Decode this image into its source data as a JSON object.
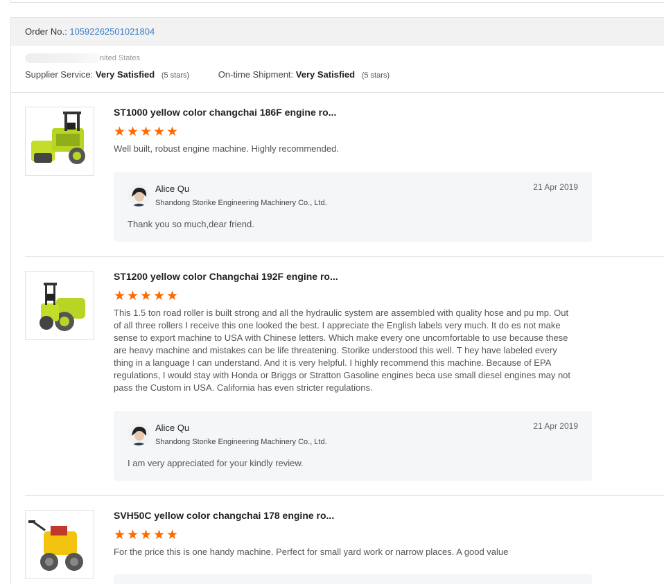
{
  "order": {
    "label": "Order No.:",
    "number": "10592262501021804"
  },
  "buyer": {
    "country": "nited States"
  },
  "ratings": {
    "supplier_service": {
      "label": "Supplier Service:",
      "value": "Very Satisfied",
      "stars": "(5 stars)"
    },
    "shipment": {
      "label": "On-time Shipment:",
      "value": "Very Satisfied",
      "stars": "(5 stars)"
    }
  },
  "colors": {
    "star": "#ff6a00",
    "link": "#3c7fc4",
    "reply_bg": "#f5f6f8"
  },
  "reviews": [
    {
      "title": "ST1000 yellow color changchai 186F engine ro...",
      "rating": 5,
      "text": "Well built, robust engine machine. Highly recommended.",
      "reply": {
        "name": "Alice Qu",
        "company": "Shandong Storike Engineering Machinery Co., Ltd.",
        "date": "21 Apr 2019",
        "message": "Thank you so much,dear friend."
      }
    },
    {
      "title": "ST1200 yellow color Changchai 192F engine ro...",
      "rating": 5,
      "text": "This 1.5 ton road roller is built strong and all the hydraulic system are assembled with quality hose and pu mp. Out of all three rollers I receive this one looked the best. I appreciate the English labels very much. It do es not make sense to export machine to USA with Chinese letters. Which make every one uncomfortable to use because these are heavy machine and mistakes can be life threatening. Storike understood this well. T hey have labeled every thing in a language I can understand. And it is very helpful. I highly recommend this machine. Because of EPA regulations, I would stay with Honda or Briggs or Stratton Gasoline engines beca use small diesel engines may not pass the Custom in USA. California has even stricter regulations.",
      "reply": {
        "name": "Alice Qu",
        "company": "Shandong Storike Engineering Machinery Co., Ltd.",
        "date": "21 Apr 2019",
        "message": "I am very appreciated for your kindly review."
      }
    },
    {
      "title": "SVH50C yellow color changchai 178 engine ro...",
      "rating": 5,
      "text": "For the price this is one handy machine. Perfect for small yard work or narrow places. A good value"
    }
  ]
}
